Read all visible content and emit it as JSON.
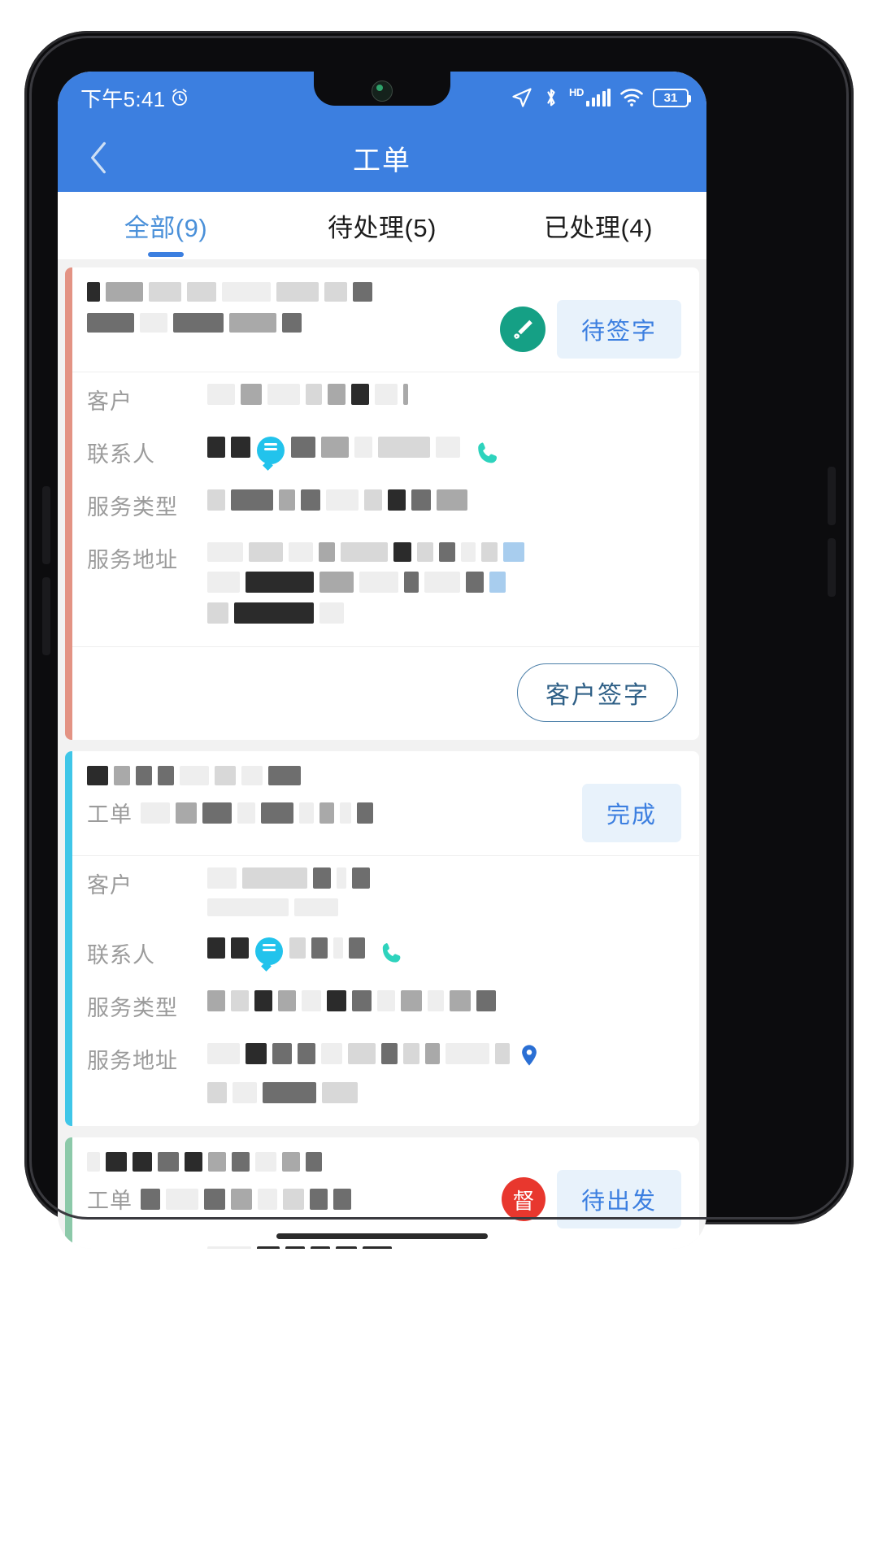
{
  "status_bar": {
    "time": "下午5:41",
    "alarm_icon": "alarm-icon",
    "location_icon": "location-arrow-icon",
    "bluetooth_icon": "bluetooth-icon",
    "hd_label": "HD",
    "signal_icon": "signal-bars-icon",
    "wifi_icon": "wifi-icon",
    "battery_level": "31"
  },
  "app_bar": {
    "back_icon": "chevron-left-icon",
    "title": "工单"
  },
  "tabs": [
    {
      "label": "全部(9)",
      "active": true
    },
    {
      "label": "待处理(5)",
      "active": false
    },
    {
      "label": "已处理(4)",
      "active": false
    }
  ],
  "row_labels": {
    "customer": "客户",
    "contact": "联系人",
    "service_type": "服务类型",
    "service_address": "服务地址",
    "work_order": "工单"
  },
  "cards": [
    {
      "accent_color": "#e39384",
      "badge": "待签字",
      "sign_icon": "signature-pen-icon",
      "footer_button": "客户签字",
      "has_phone_icon": true,
      "phone_icon": "phone-icon",
      "chat_icon": "chat-bubble-icon",
      "has_map_pin": false
    },
    {
      "accent_color": "#3fc6e8",
      "badge": "完成",
      "order_label": "工单",
      "has_phone_icon": true,
      "phone_icon": "phone-icon",
      "chat_icon": "chat-bubble-icon",
      "has_map_pin": true,
      "map_pin_icon": "map-pin-icon"
    },
    {
      "accent_color": "#8cc9a9",
      "badge": "待出发",
      "order_label": "工单",
      "urgent_badge": "督",
      "urgent_icon": "supervise-badge-icon"
    }
  ],
  "colors": {
    "header_blue": "#3c7fe0",
    "tab_active": "#4a90d9",
    "badge_bg": "#e8f2fb",
    "badge_text": "#3c7fe0",
    "sign_icon_bg": "#15a085",
    "urgent_bg": "#e8372e",
    "phone_icon": "#2ed3bd",
    "chat_icon": "#22c3ec",
    "map_pin": "#2a6fd4"
  }
}
